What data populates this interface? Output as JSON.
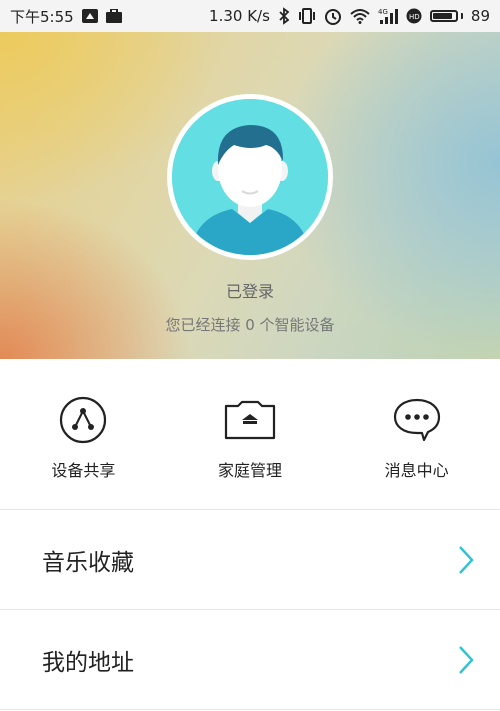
{
  "status_bar": {
    "time": "下午5:55",
    "network_speed": "1.30 K/s",
    "battery_level": "89",
    "battery_fraction": 0.89,
    "left_icons": [
      "notification-icon",
      "briefcase-icon"
    ],
    "right_icons": [
      "bluetooth-icon",
      "vibrate-icon",
      "alarm-icon",
      "wifi-icon",
      "signal-4g-icon",
      "hd-icon",
      "battery-icon"
    ]
  },
  "profile": {
    "login_status": "已登录",
    "device_count_text": "您已经连接 0 个智能设备",
    "avatar_icon": "user-avatar-icon",
    "accent": "#63dee3"
  },
  "actions": [
    {
      "label": "设备共享",
      "icon": "share-icon"
    },
    {
      "label": "家庭管理",
      "icon": "home-folder-icon"
    },
    {
      "label": "消息中心",
      "icon": "message-icon"
    }
  ],
  "list": [
    {
      "label": "音乐收藏",
      "icon": "chevron-right-icon"
    },
    {
      "label": "我的地址",
      "icon": "chevron-right-icon"
    }
  ],
  "colors": {
    "chevron": "#2fc3d2",
    "text_primary": "#222222",
    "divider": "#e6e6e6"
  }
}
